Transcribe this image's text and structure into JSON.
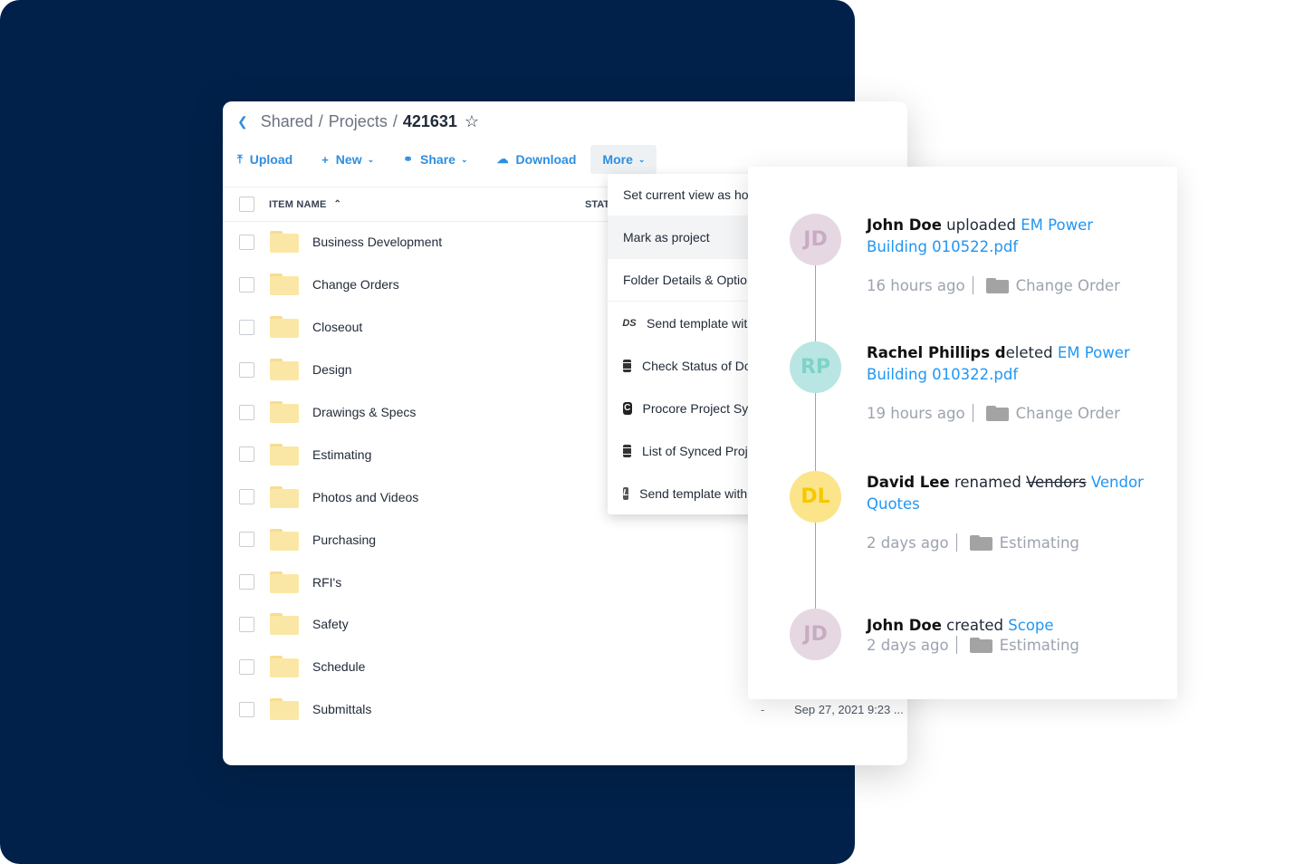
{
  "breadcrumb": {
    "back_icon": "chevron-left-icon",
    "parts": [
      "Shared",
      "Projects"
    ],
    "current": "421631",
    "separator": "/",
    "star_icon": "star-outline-icon"
  },
  "toolbar": {
    "upload": "Upload",
    "new": "New",
    "share": "Share",
    "download": "Download",
    "more": "More"
  },
  "table": {
    "columns": {
      "name": "ITEM NAME",
      "status": "STATUS"
    },
    "rows": [
      {
        "name": "Business Development"
      },
      {
        "name": "Change Orders"
      },
      {
        "name": "Closeout"
      },
      {
        "name": "Design"
      },
      {
        "name": "Drawings & Specs"
      },
      {
        "name": "Estimating"
      },
      {
        "name": "Photos and Videos"
      },
      {
        "name": "Purchasing"
      },
      {
        "name": "RFI's"
      },
      {
        "name": "Safety"
      },
      {
        "name": "Schedule"
      },
      {
        "name": "Submittals",
        "status": "-",
        "modified": "Sep 27, 2021 9:23 ..."
      }
    ]
  },
  "more_menu": {
    "items": [
      {
        "label": "Set current view as home",
        "icon": null
      },
      {
        "label": "Mark as project",
        "icon": null,
        "highlighted": true
      },
      {
        "label": "Folder Details & Options",
        "icon": null
      },
      {
        "label": "Send template with DocuSign",
        "icon": "docusign-icon"
      },
      {
        "label": "Check Status of DocuSign",
        "icon": "list-icon"
      },
      {
        "label": "Procore Project Sync",
        "icon": "procore-icon"
      },
      {
        "label": "List of Synced Projects",
        "icon": "list-icon"
      },
      {
        "label": "Send template with signature",
        "icon": "signature-icon"
      }
    ]
  },
  "activity": {
    "entries": [
      {
        "initials": "JD",
        "avatar_bg": "#e6d8e3",
        "avatar_fg": "#c9abc3",
        "actor": "John Doe",
        "verb": " uploaded ",
        "target": "EM Power Building 010522.pdf",
        "time": "16 hours ago",
        "folder": "Change Order"
      },
      {
        "initials": "RP",
        "avatar_bg": "#b9e6e2",
        "avatar_fg": "#7fd2c9",
        "actor": "Rachel Phillips d",
        "verb": "eleted ",
        "target": "EM Power Building 010322.pdf",
        "time": "19 hours ago",
        "folder": "Change Order"
      },
      {
        "initials": "DL",
        "avatar_bg": "#fbe48a",
        "avatar_fg": "#f5c800",
        "actor": "David Lee",
        "verb": " renamed ",
        "old_name": "Vendors",
        "target": "Vendor Quotes",
        "time": "2 days ago",
        "folder": "Estimating"
      },
      {
        "initials": "JD",
        "avatar_bg": "#e6d8e3",
        "avatar_fg": "#c9abc3",
        "actor": "John Doe",
        "verb": " created ",
        "target": "Scope",
        "time": "2 days ago",
        "folder": "Estimating"
      }
    ]
  },
  "colors": {
    "background": "#02214a",
    "accent": "#2e8ee0",
    "link": "#2196f3"
  }
}
